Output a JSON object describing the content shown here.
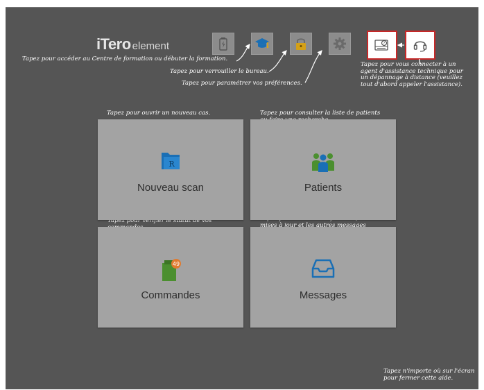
{
  "logo": {
    "brand": "iTero",
    "sub": "element"
  },
  "hints": {
    "training": "Tapez pour accéder au Centre de formation ou débuter la formation.",
    "lock": "Tapez pour verrouiller le bureau.",
    "settings": "Tapez pour paramétrer vos préférences.",
    "remote_support": "Tapez pour vous connecter à un\nagent d'assistance technique pour\nun dépannage à distance (veuillez\ntout d'abord appeler l'assistance).",
    "new_scan": "Tapez pour ouvrir un nouveau cas.",
    "patients": "Tapez pour consulter la liste de patients\nou faire une recherche.",
    "orders": "Tapez pour vérifier le statut de vos\ncommandes.",
    "messages": "Tapez pour voir les notifications, les\nmises à jour et les autres messages\nd'Align.",
    "close_help": "Tapez n'importe où sur l'écran\npour fermer cette aide."
  },
  "tiles": {
    "new_scan": {
      "label": "Nouveau scan",
      "icon": "folder-rx-icon"
    },
    "patients": {
      "label": "Patients",
      "icon": "patients-icon"
    },
    "orders": {
      "label": "Commandes",
      "icon": "orders-icon",
      "badge": "49"
    },
    "messages": {
      "label": "Messages",
      "icon": "inbox-icon"
    }
  },
  "toolbar": {
    "icons": [
      "battery-icon",
      "graduation-cap-icon",
      "lock-icon",
      "gear-icon",
      "remote-support-icon",
      "headset-icon"
    ]
  },
  "colors": {
    "screen_bg": "#555555",
    "tile_bg": "#a3a3a3",
    "highlight_border": "#c62828",
    "badge": "#e07a2e",
    "icon_blue": "#1a6fb5",
    "icon_green": "#4b8f2f"
  }
}
